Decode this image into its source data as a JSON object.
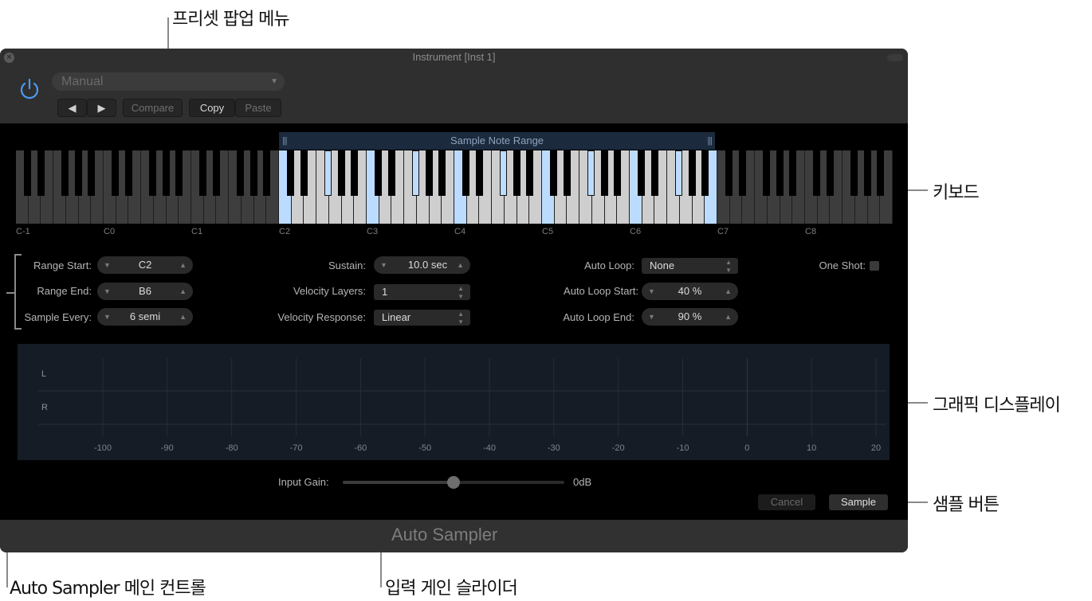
{
  "callouts": {
    "preset_menu": "프리셋 팝업 메뉴",
    "keyboard": "키보드",
    "graphic_display": "그래픽 디스플레이",
    "sample_button": "샘플 버튼",
    "main_controls": "Auto Sampler 메인 컨트롤",
    "input_gain_slider": "입력 게인 슬라이더"
  },
  "window": {
    "title": "Instrument [Inst 1]",
    "plugin_name": "Auto Sampler",
    "accent_color": "#4a9cf0"
  },
  "header": {
    "preset": "Manual",
    "prev_icon": "◀",
    "next_icon": "▶",
    "compare_label": "Compare",
    "copy_label": "Copy",
    "paste_label": "Paste"
  },
  "keyboard": {
    "range_label": "Sample Note Range",
    "range_grip": "|||",
    "first_octave": -1,
    "octave_labels": [
      "C-1",
      "C0",
      "C1",
      "C2",
      "C3",
      "C4",
      "C5",
      "C6",
      "C7",
      "C8"
    ],
    "range_start_note": "C2",
    "range_end_note": "B6",
    "sample_interval_semitones": 6,
    "highlight_color": "#bcdcff"
  },
  "controls": {
    "range_start": {
      "label": "Range Start:",
      "value": "C2"
    },
    "range_end": {
      "label": "Range End:",
      "value": "B6"
    },
    "sample_every": {
      "label": "Sample Every:",
      "value": "6 semi"
    },
    "sustain": {
      "label": "Sustain:",
      "value": "10.0 sec"
    },
    "velocity_layers": {
      "label": "Velocity Layers:",
      "value": "1"
    },
    "velocity_response": {
      "label": "Velocity Response:",
      "value": "Linear"
    },
    "auto_loop": {
      "label": "Auto Loop:",
      "value": "None"
    },
    "auto_loop_start": {
      "label": "Auto Loop Start:",
      "value": "40 %"
    },
    "auto_loop_end": {
      "label": "Auto Loop End:",
      "value": "90 %"
    },
    "one_shot": {
      "label": "One Shot:",
      "checked": false
    }
  },
  "meter": {
    "channels": [
      "L",
      "R"
    ],
    "scale": [
      "-100",
      "-90",
      "-80",
      "-70",
      "-60",
      "-50",
      "-40",
      "-30",
      "-20",
      "-10",
      "0",
      "10",
      "20"
    ]
  },
  "input_gain": {
    "label": "Input Gain:",
    "value": "0dB",
    "position_fraction": 0.5
  },
  "actions": {
    "cancel_label": "Cancel",
    "sample_label": "Sample"
  }
}
